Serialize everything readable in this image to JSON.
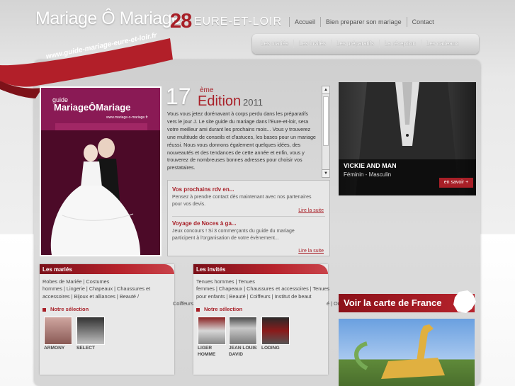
{
  "header": {
    "logo_text": "Mariage Ô Mariage",
    "dept_number": "28",
    "dept_name": "EURE-ET-LOIR",
    "top_links": [
      "Accueil",
      "Bien preparer son mariage",
      "Contact"
    ],
    "main_nav": [
      "Les mariés",
      "Les invités",
      "Les préparatifs",
      "La réception",
      "Les cadeaux"
    ],
    "site_url": "www.guide-mariage-eure-et-loir.fr"
  },
  "cover": {
    "guide_label": "guide",
    "title": "MariageÔMariage",
    "url": "www.mariage-o-mariage.fr"
  },
  "edition": {
    "number": "17",
    "suffix": "ème",
    "word": "Edition",
    "year": "2011",
    "text": "Vous vous jetez dorénavant à corps perdu dans les préparatifs vers le jour J. Le site guide du mariage dans l'Eure-et-loir, sera votre meilleur ami durant les prochains mois... Vous y trouverez une multitude de conseils et d'astuces, les bases pour un mariage réussi. Nous vous donnons également quelques idées, des nouveautés et des tendances de cette année et enfin, vous y trouverez de nombreuses bonnes adresses pour choisir vos prestataires."
  },
  "news": [
    {
      "title": "Vos prochains rdv en...",
      "body": "Pensez à prendre contact dès maintenant avec nos partenaires pour vos devis.",
      "more": "Lire la suite"
    },
    {
      "title": "Voyage de Noces à ga...",
      "body": "Jeux concours ! Si 3 commerçants du guide du mariage participent à l'organisation de votre évènement...",
      "more": "Lire la suite"
    }
  ],
  "hero": {
    "title": "VICKIE AND MAN",
    "subtitle": "Féminin - Masculin",
    "button": "en savoir +"
  },
  "cat_maries": {
    "title": "Les mariés",
    "tag_lines": [
      "Robes de Mariée | Costumes",
      "hommes | Lingerie | Chapeaux | Chaussures et",
      "accessoires | Bijoux et alliances | Beauté /"
    ],
    "overflow_tag": "Coiffeurs",
    "selection_title": "Notre sélection",
    "items": [
      {
        "label": "ARMONY"
      },
      {
        "label": "SELECT"
      }
    ]
  },
  "cat_invites": {
    "title": "Les invités",
    "tag_lines": [
      "Tenues hommes | Tenues",
      "femmes | Chapeaux | Chaussures et accessoires | Tenues",
      "pour enfants | Beauté | Coiffeurs | Institut de beaut"
    ],
    "overflow_tag": "é | Or",
    "selection_title": "Notre sélection",
    "items": [
      {
        "label": "LIGER HOMME"
      },
      {
        "label": "JEAN LOUIS DAVID"
      },
      {
        "label": "LODING"
      }
    ]
  },
  "france": {
    "label": "Voir la carte de France"
  },
  "colors": {
    "accent": "#a81f27",
    "background": "#e3e3e3"
  }
}
